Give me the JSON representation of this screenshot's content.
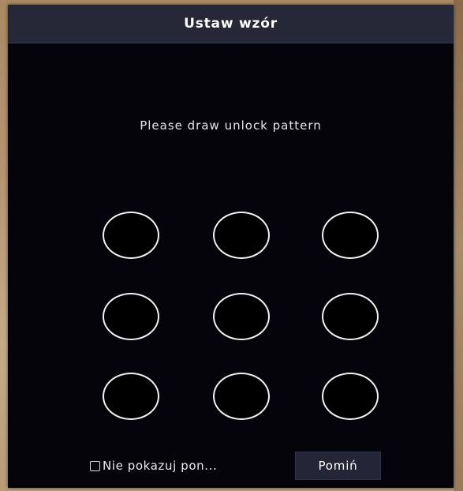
{
  "dialog": {
    "title": "Ustaw wzór",
    "prompt": "Please draw unlock pattern"
  },
  "pattern": {
    "rows": 3,
    "columns": 3,
    "dot_count": 9
  },
  "footer": {
    "dont_show_label": "Nie pokazuj pon...",
    "dont_show_checked": false,
    "skip_label": "Pomiń"
  },
  "colors": {
    "dialog_background": "#04040a",
    "title_bar": "#262838",
    "dot_outline": "#f2f2f2",
    "button_background": "#242637"
  }
}
